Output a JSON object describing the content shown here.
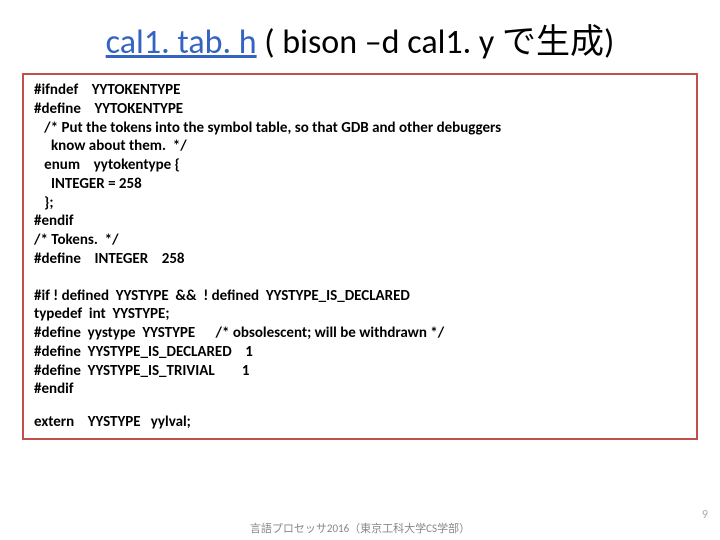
{
  "title": {
    "file": "cal1. tab. h",
    "rest": " ( bison –d cal1. y で生成)"
  },
  "block1": {
    "l1": "#ifndef    YYTOKENTYPE",
    "l2": "#define    YYTOKENTYPE",
    "l3": "   /* Put the tokens into the symbol table, so that GDB and other debuggers",
    "l4": "     know about them.  */",
    "l5": "   enum    yytokentype {",
    "l6": "     INTEGER = 258",
    "l7": "   };",
    "l8": "#endif",
    "l9": "/* Tokens.  */",
    "l10": "#define    INTEGER    258"
  },
  "block2": {
    "l1": "#if ! defined  YYSTYPE  &&  ! defined  YYSTYPE_IS_DECLARED",
    "l2": "typedef  int  YYSTYPE;",
    "l3": "#define  yystype  YYSTYPE      /* obsolescent; will be withdrawn */",
    "l4": "#define  YYSTYPE_IS_DECLARED    1",
    "l5": "#define  YYSTYPE_IS_TRIVIAL        1",
    "l6": "#endif"
  },
  "footer": {
    "l1": "extern    YYSTYPE   yylval;"
  },
  "caption": "言語プロセッサ2016（東京工科大学CS学部）",
  "pagenum": "9"
}
